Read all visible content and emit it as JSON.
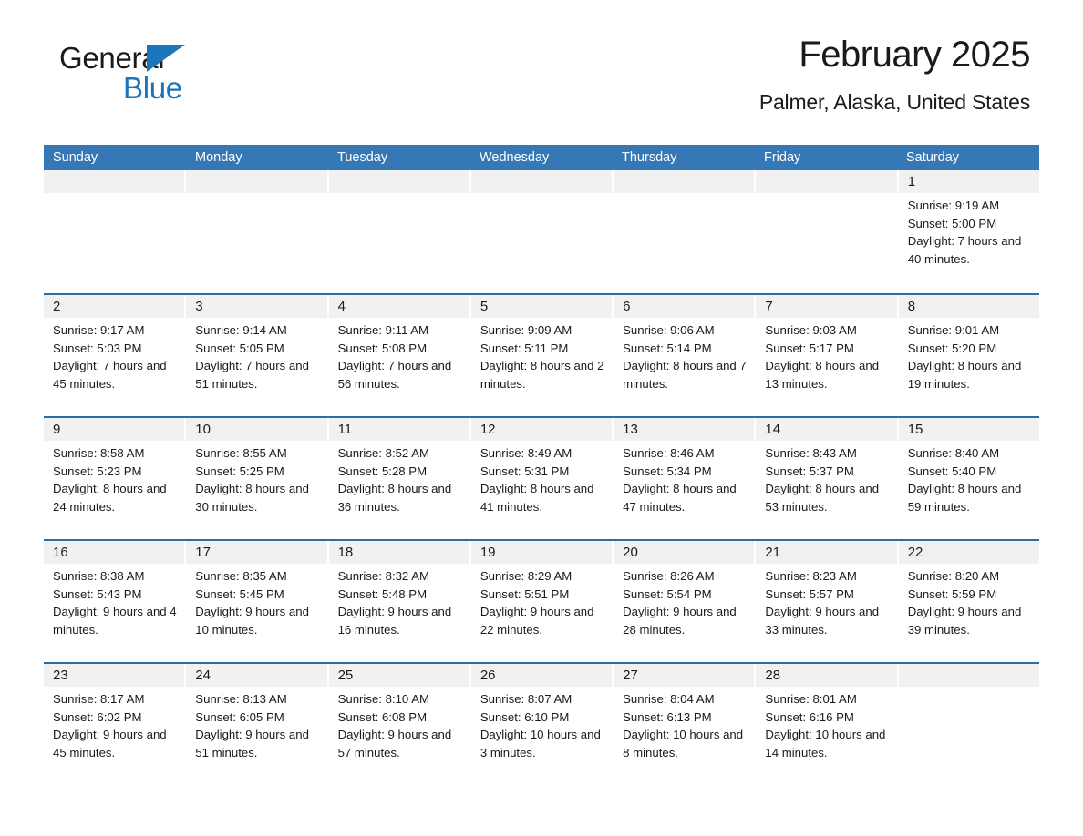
{
  "logo": {
    "word1": "General",
    "word2": "Blue",
    "accent_color": "#1b75bb",
    "triangle_icon": "triangle-icon"
  },
  "header": {
    "month_title": "February 2025",
    "location": "Palmer, Alaska, United States"
  },
  "theme": {
    "header_blue": "#3578b5",
    "row_separator_blue": "#2e6da4",
    "daynum_band_gray": "#f1f1f1",
    "text_color": "#1a1a1a"
  },
  "weekdays": [
    "Sunday",
    "Monday",
    "Tuesday",
    "Wednesday",
    "Thursday",
    "Friday",
    "Saturday"
  ],
  "weeks": [
    {
      "days": [
        {
          "empty": true
        },
        {
          "empty": true
        },
        {
          "empty": true
        },
        {
          "empty": true
        },
        {
          "empty": true
        },
        {
          "empty": true
        },
        {
          "day": "1",
          "sunrise": "Sunrise: 9:19 AM",
          "sunset": "Sunset: 5:00 PM",
          "daylight": "Daylight: 7 hours and 40 minutes."
        }
      ]
    },
    {
      "days": [
        {
          "day": "2",
          "sunrise": "Sunrise: 9:17 AM",
          "sunset": "Sunset: 5:03 PM",
          "daylight": "Daylight: 7 hours and 45 minutes."
        },
        {
          "day": "3",
          "sunrise": "Sunrise: 9:14 AM",
          "sunset": "Sunset: 5:05 PM",
          "daylight": "Daylight: 7 hours and 51 minutes."
        },
        {
          "day": "4",
          "sunrise": "Sunrise: 9:11 AM",
          "sunset": "Sunset: 5:08 PM",
          "daylight": "Daylight: 7 hours and 56 minutes."
        },
        {
          "day": "5",
          "sunrise": "Sunrise: 9:09 AM",
          "sunset": "Sunset: 5:11 PM",
          "daylight": "Daylight: 8 hours and 2 minutes."
        },
        {
          "day": "6",
          "sunrise": "Sunrise: 9:06 AM",
          "sunset": "Sunset: 5:14 PM",
          "daylight": "Daylight: 8 hours and 7 minutes."
        },
        {
          "day": "7",
          "sunrise": "Sunrise: 9:03 AM",
          "sunset": "Sunset: 5:17 PM",
          "daylight": "Daylight: 8 hours and 13 minutes."
        },
        {
          "day": "8",
          "sunrise": "Sunrise: 9:01 AM",
          "sunset": "Sunset: 5:20 PM",
          "daylight": "Daylight: 8 hours and 19 minutes."
        }
      ]
    },
    {
      "days": [
        {
          "day": "9",
          "sunrise": "Sunrise: 8:58 AM",
          "sunset": "Sunset: 5:23 PM",
          "daylight": "Daylight: 8 hours and 24 minutes."
        },
        {
          "day": "10",
          "sunrise": "Sunrise: 8:55 AM",
          "sunset": "Sunset: 5:25 PM",
          "daylight": "Daylight: 8 hours and 30 minutes."
        },
        {
          "day": "11",
          "sunrise": "Sunrise: 8:52 AM",
          "sunset": "Sunset: 5:28 PM",
          "daylight": "Daylight: 8 hours and 36 minutes."
        },
        {
          "day": "12",
          "sunrise": "Sunrise: 8:49 AM",
          "sunset": "Sunset: 5:31 PM",
          "daylight": "Daylight: 8 hours and 41 minutes."
        },
        {
          "day": "13",
          "sunrise": "Sunrise: 8:46 AM",
          "sunset": "Sunset: 5:34 PM",
          "daylight": "Daylight: 8 hours and 47 minutes."
        },
        {
          "day": "14",
          "sunrise": "Sunrise: 8:43 AM",
          "sunset": "Sunset: 5:37 PM",
          "daylight": "Daylight: 8 hours and 53 minutes."
        },
        {
          "day": "15",
          "sunrise": "Sunrise: 8:40 AM",
          "sunset": "Sunset: 5:40 PM",
          "daylight": "Daylight: 8 hours and 59 minutes."
        }
      ]
    },
    {
      "days": [
        {
          "day": "16",
          "sunrise": "Sunrise: 8:38 AM",
          "sunset": "Sunset: 5:43 PM",
          "daylight": "Daylight: 9 hours and 4 minutes."
        },
        {
          "day": "17",
          "sunrise": "Sunrise: 8:35 AM",
          "sunset": "Sunset: 5:45 PM",
          "daylight": "Daylight: 9 hours and 10 minutes."
        },
        {
          "day": "18",
          "sunrise": "Sunrise: 8:32 AM",
          "sunset": "Sunset: 5:48 PM",
          "daylight": "Daylight: 9 hours and 16 minutes."
        },
        {
          "day": "19",
          "sunrise": "Sunrise: 8:29 AM",
          "sunset": "Sunset: 5:51 PM",
          "daylight": "Daylight: 9 hours and 22 minutes."
        },
        {
          "day": "20",
          "sunrise": "Sunrise: 8:26 AM",
          "sunset": "Sunset: 5:54 PM",
          "daylight": "Daylight: 9 hours and 28 minutes."
        },
        {
          "day": "21",
          "sunrise": "Sunrise: 8:23 AM",
          "sunset": "Sunset: 5:57 PM",
          "daylight": "Daylight: 9 hours and 33 minutes."
        },
        {
          "day": "22",
          "sunrise": "Sunrise: 8:20 AM",
          "sunset": "Sunset: 5:59 PM",
          "daylight": "Daylight: 9 hours and 39 minutes."
        }
      ]
    },
    {
      "days": [
        {
          "day": "23",
          "sunrise": "Sunrise: 8:17 AM",
          "sunset": "Sunset: 6:02 PM",
          "daylight": "Daylight: 9 hours and 45 minutes."
        },
        {
          "day": "24",
          "sunrise": "Sunrise: 8:13 AM",
          "sunset": "Sunset: 6:05 PM",
          "daylight": "Daylight: 9 hours and 51 minutes."
        },
        {
          "day": "25",
          "sunrise": "Sunrise: 8:10 AM",
          "sunset": "Sunset: 6:08 PM",
          "daylight": "Daylight: 9 hours and 57 minutes."
        },
        {
          "day": "26",
          "sunrise": "Sunrise: 8:07 AM",
          "sunset": "Sunset: 6:10 PM",
          "daylight": "Daylight: 10 hours and 3 minutes."
        },
        {
          "day": "27",
          "sunrise": "Sunrise: 8:04 AM",
          "sunset": "Sunset: 6:13 PM",
          "daylight": "Daylight: 10 hours and 8 minutes."
        },
        {
          "day": "28",
          "sunrise": "Sunrise: 8:01 AM",
          "sunset": "Sunset: 6:16 PM",
          "daylight": "Daylight: 10 hours and 14 minutes."
        },
        {
          "empty": true
        }
      ]
    }
  ]
}
